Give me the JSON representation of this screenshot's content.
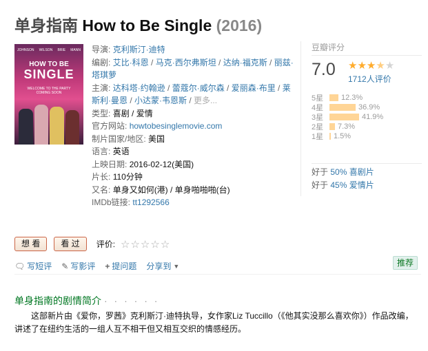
{
  "title": {
    "cn": "单身指南",
    "en": "How to Be Single",
    "year": "(2016)"
  },
  "poster": {
    "cast": [
      "JOHNSON",
      "WILSON",
      "BRIE",
      "MANN"
    ],
    "line1": "HOW TO BE",
    "line2": "SINGLE",
    "tagline": "WELCOME TO THE PARTY",
    "coming": "COMING SOON"
  },
  "info": {
    "director_label": "导演:",
    "director": "克利斯汀·迪特",
    "writers_label": "编剧:",
    "writers": [
      "艾比·科恩",
      "马克·西尔弗斯坦",
      "达纳·福克斯",
      "丽兹·塔琪萝"
    ],
    "cast_label": "主演:",
    "cast": [
      "达科塔·约翰逊",
      "蕾蔻尔·威尔森",
      "爱丽森·布里",
      "莱斯利·曼恩",
      "小达蒙·韦恩斯"
    ],
    "cast_more": "更多...",
    "genre_label": "类型:",
    "genre": "喜剧 / 爱情",
    "site_label": "官方网站:",
    "site": "howtobesinglemovie.com",
    "country_label": "制片国家/地区:",
    "country": "美国",
    "language_label": "语言:",
    "language": "英语",
    "release_label": "上映日期:",
    "release": "2016-02-12(美国)",
    "runtime_label": "片长:",
    "runtime": "110分钟",
    "aka_label": "又名:",
    "aka": "单身又如何(港) / 单身啪啪啪(台)",
    "imdb_label": "IMDb链接:",
    "imdb": "tt1292566"
  },
  "rating": {
    "header": "豆瓣评分",
    "score": "7.0",
    "stars_value": 3.5,
    "votes": "1712人评价",
    "distribution": [
      {
        "label": "5星",
        "percent": "12.3%",
        "value": 12.3
      },
      {
        "label": "4星",
        "percent": "36.9%",
        "value": 36.9
      },
      {
        "label": "3星",
        "percent": "41.9%",
        "value": 41.9
      },
      {
        "label": "2星",
        "percent": "7.3%",
        "value": 7.3
      },
      {
        "label": "1星",
        "percent": "1.5%",
        "value": 1.5
      }
    ],
    "better1_prefix": "好于",
    "better1_link": "50% 喜剧片",
    "better2_prefix": "好于",
    "better2_link": "45% 爱情片"
  },
  "actions": {
    "want": "想 看",
    "seen": "看 过",
    "rate_label": "评价:"
  },
  "tools": {
    "short_review": "写短评",
    "review": "写影评",
    "question": "提问题",
    "share": "分享到",
    "recommend": "推荐"
  },
  "summary": {
    "heading": "单身指南的剧情简介",
    "dots": "· · · · · ·",
    "text": "这部新片由《爱你，罗茜》克利斯汀·迪特执导，女作家Liz Tuccillo（《他其实没那么喜欢你》）作品改编，讲述了在纽约生活的一组人互不相干但又相互交织的情感经历。"
  },
  "colors": {
    "link": "#3377aa",
    "star": "#ffac2d",
    "bar": "#ffd596",
    "section": "#007722",
    "button_border": "#ca6445"
  }
}
